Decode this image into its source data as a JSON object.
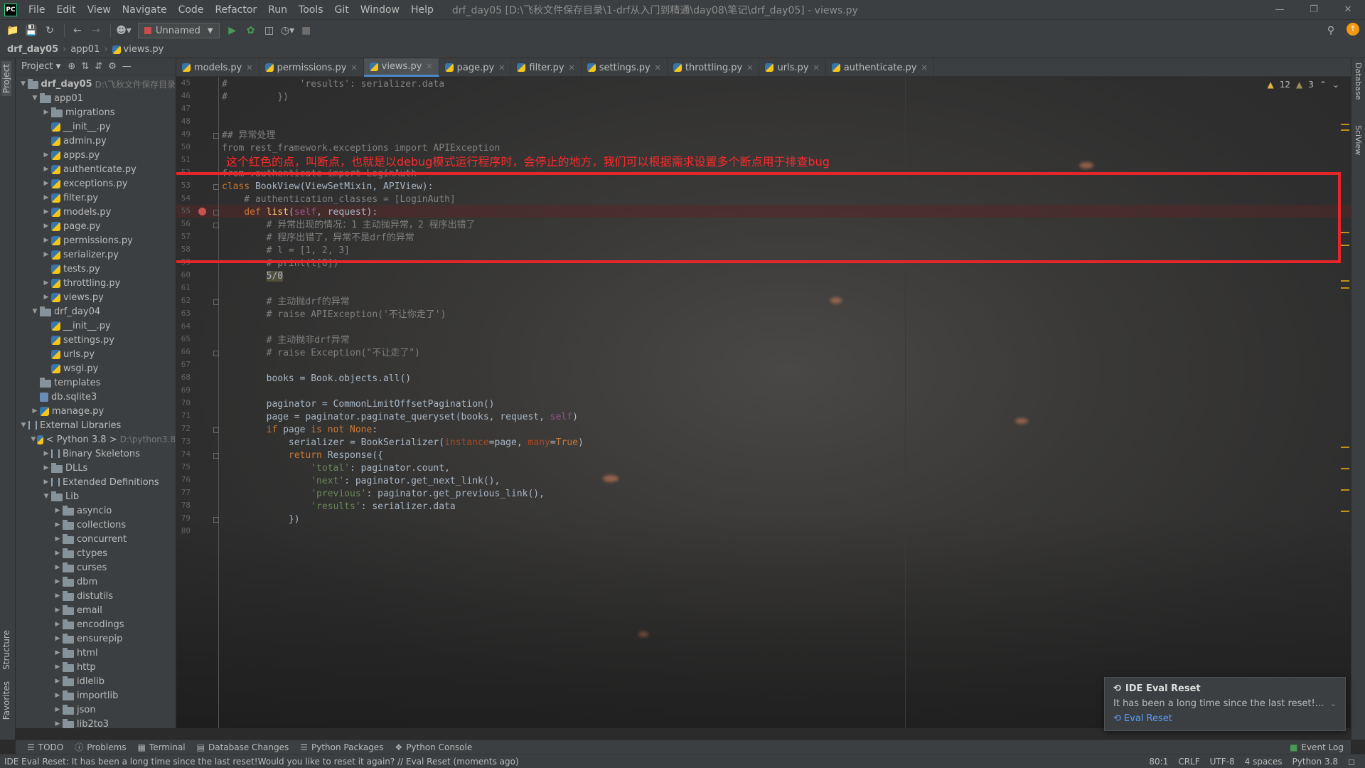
{
  "titlebar": {
    "menu": [
      "File",
      "Edit",
      "View",
      "Navigate",
      "Code",
      "Refactor",
      "Run",
      "Tools",
      "Git",
      "Window",
      "Help"
    ],
    "title": "drf_day05 [D:\\飞秋文件保存目录\\1-drf从入门到精通\\day08\\笔记\\drf_day05] - views.py",
    "logo": "PC"
  },
  "toolbar": {
    "run_config": "Unnamed"
  },
  "breadcrumbs": [
    "drf_day05",
    "app01",
    "views.py"
  ],
  "left_tabs": {
    "project": "Project",
    "structure": "Structure",
    "favorites": "Favorites"
  },
  "right_tabs": {
    "database": "Database",
    "sciview": "SciView"
  },
  "project_panel": {
    "header": "Project",
    "root_label": "drf_day05",
    "root_path": "D:\\飞秋文件保存目录",
    "python_label": "< Python 3.8 >",
    "python_path": "D:\\python3.8"
  },
  "tree": [
    {
      "label": "app01",
      "type": "folder",
      "depth": 1,
      "open": true
    },
    {
      "label": "migrations",
      "type": "folder",
      "depth": 2,
      "open": false
    },
    {
      "label": "__init__.py",
      "type": "py",
      "depth": 2
    },
    {
      "label": "admin.py",
      "type": "py",
      "depth": 2
    },
    {
      "label": "apps.py",
      "type": "py",
      "depth": 2,
      "collapsed": true
    },
    {
      "label": "authenticate.py",
      "type": "py",
      "depth": 2,
      "collapsed": true
    },
    {
      "label": "exceptions.py",
      "type": "py",
      "depth": 2,
      "collapsed": true
    },
    {
      "label": "filter.py",
      "type": "py",
      "depth": 2,
      "collapsed": true
    },
    {
      "label": "models.py",
      "type": "py",
      "depth": 2,
      "collapsed": true
    },
    {
      "label": "page.py",
      "type": "py",
      "depth": 2,
      "collapsed": true
    },
    {
      "label": "permissions.py",
      "type": "py",
      "depth": 2,
      "collapsed": true
    },
    {
      "label": "serializer.py",
      "type": "py",
      "depth": 2,
      "collapsed": true
    },
    {
      "label": "tests.py",
      "type": "py",
      "depth": 2
    },
    {
      "label": "throttling.py",
      "type": "py",
      "depth": 2,
      "collapsed": true
    },
    {
      "label": "views.py",
      "type": "py",
      "depth": 2,
      "collapsed": true
    },
    {
      "label": "drf_day04",
      "type": "folder",
      "depth": 1,
      "open": true
    },
    {
      "label": "__init__.py",
      "type": "py",
      "depth": 2
    },
    {
      "label": "settings.py",
      "type": "py",
      "depth": 2
    },
    {
      "label": "urls.py",
      "type": "py",
      "depth": 2
    },
    {
      "label": "wsgi.py",
      "type": "py",
      "depth": 2
    },
    {
      "label": "templates",
      "type": "folder",
      "depth": 1
    },
    {
      "label": "db.sqlite3",
      "type": "db",
      "depth": 1
    },
    {
      "label": "manage.py",
      "type": "py",
      "depth": 1,
      "collapsed": true
    },
    {
      "label": "External Libraries",
      "type": "lib",
      "depth": 0,
      "open": true
    },
    {
      "label": "Binary Skeletons",
      "type": "lib",
      "depth": 2,
      "collapsed": true
    },
    {
      "label": "DLLs",
      "type": "folder",
      "depth": 2,
      "collapsed": true
    },
    {
      "label": "Extended Definitions",
      "type": "lib",
      "depth": 2,
      "collapsed": true
    },
    {
      "label": "Lib",
      "type": "folder",
      "depth": 2,
      "open": true
    },
    {
      "label": "asyncio",
      "type": "folder",
      "depth": 3,
      "collapsed": true
    },
    {
      "label": "collections",
      "type": "folder",
      "depth": 3,
      "collapsed": true
    },
    {
      "label": "concurrent",
      "type": "folder",
      "depth": 3,
      "collapsed": true
    },
    {
      "label": "ctypes",
      "type": "folder",
      "depth": 3,
      "collapsed": true
    },
    {
      "label": "curses",
      "type": "folder",
      "depth": 3,
      "collapsed": true
    },
    {
      "label": "dbm",
      "type": "folder",
      "depth": 3,
      "collapsed": true
    },
    {
      "label": "distutils",
      "type": "folder",
      "depth": 3,
      "collapsed": true
    },
    {
      "label": "email",
      "type": "folder",
      "depth": 3,
      "collapsed": true
    },
    {
      "label": "encodings",
      "type": "folder",
      "depth": 3,
      "collapsed": true
    },
    {
      "label": "ensurepip",
      "type": "folder",
      "depth": 3,
      "collapsed": true
    },
    {
      "label": "html",
      "type": "folder",
      "depth": 3,
      "collapsed": true
    },
    {
      "label": "http",
      "type": "folder",
      "depth": 3,
      "collapsed": true
    },
    {
      "label": "idlelib",
      "type": "folder",
      "depth": 3,
      "collapsed": true
    },
    {
      "label": "importlib",
      "type": "folder",
      "depth": 3,
      "collapsed": true
    },
    {
      "label": "json",
      "type": "folder",
      "depth": 3,
      "collapsed": true
    },
    {
      "label": "lib2to3",
      "type": "folder",
      "depth": 3,
      "collapsed": true
    }
  ],
  "tabs": [
    {
      "label": "models.py",
      "active": false
    },
    {
      "label": "permissions.py",
      "active": false
    },
    {
      "label": "views.py",
      "active": true
    },
    {
      "label": "page.py",
      "active": false
    },
    {
      "label": "filter.py",
      "active": false
    },
    {
      "label": "settings.py",
      "active": false
    },
    {
      "label": "throttling.py",
      "active": false
    },
    {
      "label": "urls.py",
      "active": false
    },
    {
      "label": "authenticate.py",
      "active": false
    }
  ],
  "inspections": {
    "warnings": "12",
    "weak_warnings": "3"
  },
  "annotation": "这个红色的点，叫断点，也就是以debug模式运行程序时，会停止的地方，我们可以根据需求设置多个断点用于排查bug",
  "code_lines": [
    {
      "n": "45",
      "segs": [
        [
          "c-com",
          "#             'results': serializer.data"
        ]
      ]
    },
    {
      "n": "46",
      "segs": [
        [
          "c-com",
          "#         })"
        ]
      ]
    },
    {
      "n": "47",
      "segs": []
    },
    {
      "n": "48",
      "segs": []
    },
    {
      "n": "49",
      "segs": [
        [
          "c-com",
          "## 异常处理"
        ]
      ]
    },
    {
      "n": "50",
      "segs": [
        [
          "c-com",
          "from rest_framework.exceptions import APIException"
        ]
      ]
    },
    {
      "n": "51",
      "segs": []
    },
    {
      "n": "52",
      "segs": [
        [
          "c-com",
          "from .authenticate import LoginAuth"
        ]
      ]
    },
    {
      "n": "53",
      "segs": [
        [
          "c-kw",
          "class "
        ],
        [
          "",
          "BookView(ViewSetMixin, APIView):"
        ]
      ]
    },
    {
      "n": "54",
      "segs": [
        [
          "c-com",
          "    # authentication_classes = [LoginAuth]"
        ]
      ]
    },
    {
      "n": "55",
      "segs": [
        [
          "c-kw",
          "    def "
        ],
        [
          "c-fn",
          "list"
        ],
        [
          "",
          "("
        ],
        [
          "c-self",
          "self"
        ],
        [
          "",
          ", request):"
        ]
      ]
    },
    {
      "n": "56",
      "segs": [
        [
          "c-com",
          "        # 异常出现的情况：1 主动抛异常，2 程序出错了"
        ]
      ]
    },
    {
      "n": "57",
      "segs": [
        [
          "c-com",
          "        # 程序出错了，异常不是drf的异常"
        ]
      ]
    },
    {
      "n": "58",
      "segs": [
        [
          "c-com",
          "        # l = [1, 2, 3]"
        ]
      ]
    },
    {
      "n": "59",
      "segs": [
        [
          "c-com",
          "        # print(l[8])"
        ]
      ]
    },
    {
      "n": "60",
      "segs": [
        [
          "",
          "        "
        ],
        [
          "c-hl",
          "5/0"
        ]
      ]
    },
    {
      "n": "61",
      "segs": []
    },
    {
      "n": "62",
      "segs": [
        [
          "c-com",
          "        # 主动抛drf的异常"
        ]
      ]
    },
    {
      "n": "63",
      "segs": [
        [
          "c-com",
          "        # raise APIException('不让你走了')"
        ]
      ]
    },
    {
      "n": "64",
      "segs": []
    },
    {
      "n": "65",
      "segs": [
        [
          "c-com",
          "        # 主动抛非drf异常"
        ]
      ]
    },
    {
      "n": "66",
      "segs": [
        [
          "c-com",
          "        # raise Exception(\"不让走了\")"
        ]
      ]
    },
    {
      "n": "67",
      "segs": []
    },
    {
      "n": "68",
      "segs": [
        [
          "",
          "        books = Book.objects.all()"
        ]
      ]
    },
    {
      "n": "69",
      "segs": []
    },
    {
      "n": "70",
      "segs": [
        [
          "",
          "        paginator = CommonLimitOffsetPagination()"
        ]
      ]
    },
    {
      "n": "71",
      "segs": [
        [
          "",
          "        page = paginator.paginate_queryset(books, request, "
        ],
        [
          "c-self",
          "self"
        ],
        [
          "",
          ")"
        ]
      ]
    },
    {
      "n": "72",
      "segs": [
        [
          "c-kw",
          "        if "
        ],
        [
          "",
          "page "
        ],
        [
          "c-kw",
          "is not None"
        ],
        [
          "",
          ":"
        ]
      ]
    },
    {
      "n": "73",
      "segs": [
        [
          "",
          "            serializer = BookSerializer("
        ],
        [
          "c-param",
          "instance"
        ],
        [
          "",
          "=page, "
        ],
        [
          "c-param",
          "many"
        ],
        [
          "",
          "="
        ],
        [
          "c-kw",
          "True"
        ],
        [
          "",
          ")"
        ]
      ]
    },
    {
      "n": "74",
      "segs": [
        [
          "c-kw",
          "            return "
        ],
        [
          "",
          "Response({"
        ]
      ]
    },
    {
      "n": "75",
      "segs": [
        [
          "c-str",
          "                'total'"
        ],
        [
          "",
          ": paginator.count,"
        ]
      ]
    },
    {
      "n": "76",
      "segs": [
        [
          "c-str",
          "                'next'"
        ],
        [
          "",
          ": paginator.get_next_link(),"
        ]
      ]
    },
    {
      "n": "77",
      "segs": [
        [
          "c-str",
          "                'previous'"
        ],
        [
          "",
          ": paginator.get_previous_link(),"
        ]
      ]
    },
    {
      "n": "78",
      "segs": [
        [
          "c-str",
          "                'results'"
        ],
        [
          "",
          ": serializer.data"
        ]
      ]
    },
    {
      "n": "79",
      "segs": [
        [
          "",
          "            })"
        ]
      ]
    },
    {
      "n": "80",
      "segs": []
    }
  ],
  "notification": {
    "title": "IDE Eval Reset",
    "body": "It has been a long time since the last reset!...",
    "link": "Eval Reset"
  },
  "toolwindows": [
    "TODO",
    "Problems",
    "Terminal",
    "Database Changes",
    "Python Packages",
    "Python Console"
  ],
  "event_log": "Event Log",
  "statusbar": {
    "message": "IDE Eval Reset: It has been a long time since the last reset!Would you like to reset it again? // Eval Reset (moments ago)",
    "position": "80:1",
    "line_sep": "CRLF",
    "encoding": "UTF-8",
    "indent": "4 spaces",
    "interpreter": "Python 3.8"
  },
  "colors": {
    "accent": "#4a88c7",
    "breakpoint": "#c75450",
    "annotation_red": "#e5262a",
    "link": "#589df6"
  }
}
